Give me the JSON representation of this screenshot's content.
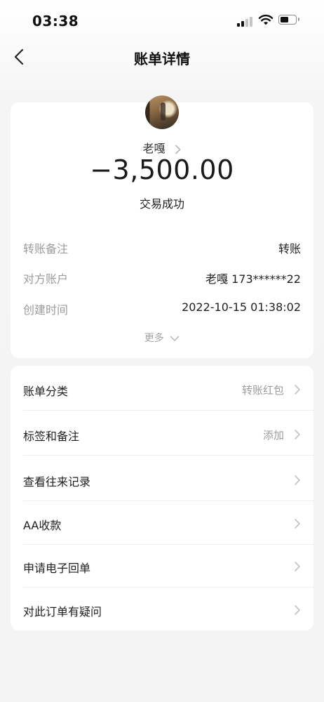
{
  "status_bar": {
    "time": "03:38"
  },
  "nav": {
    "title": "账单详情",
    "back_icon": "chevron-left-icon"
  },
  "summary": {
    "payee_name": "老嘎",
    "amount": "−3,500.00",
    "status": "交易成功",
    "details": [
      {
        "label": "转账备注",
        "value": "转账"
      },
      {
        "label": "对方账户",
        "value": "老嘎 173******22"
      },
      {
        "label": "创建时间",
        "value": "2022-10-15 01:38:02"
      }
    ],
    "more_label": "更多"
  },
  "menu": {
    "items": [
      {
        "label": "账单分类",
        "value": "转账红包"
      },
      {
        "label": "标签和备注",
        "value": "添加"
      },
      {
        "label": "查看往来记录",
        "value": ""
      },
      {
        "label": "AA收款",
        "value": ""
      },
      {
        "label": "申请电子回单",
        "value": ""
      },
      {
        "label": "对此订单有疑问",
        "value": ""
      }
    ]
  },
  "colors": {
    "background": "#f4f4f4",
    "card": "#ffffff",
    "muted_text": "#9b9b9b",
    "primary_text": "#1f1f1f"
  }
}
